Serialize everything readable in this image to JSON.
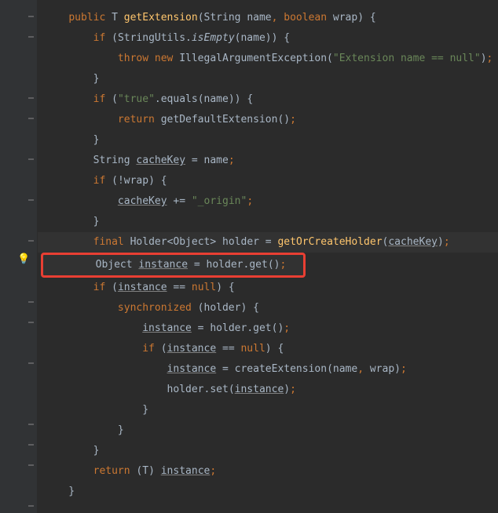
{
  "code": {
    "kw_public": "public",
    "type_T": "T",
    "method_getExtension": "getExtension",
    "type_String": "String",
    "param_name": "name",
    "kw_boolean": "boolean",
    "param_wrap": "wrap",
    "kw_if": "if",
    "cls_StringUtils": "StringUtils",
    "method_isEmpty": "isEmpty",
    "kw_throw": "throw",
    "kw_new": "new",
    "cls_IllegalArgumentException": "IllegalArgumentException",
    "str_extension_null": "\"Extension name == null\"",
    "str_true": "\"true\"",
    "method_equals": "equals",
    "kw_return": "return",
    "method_getDefaultExtension": "getDefaultExtension",
    "var_cacheKey": "cacheKey",
    "op_assign": " = ",
    "op_not": "!",
    "op_plus_assign": " += ",
    "str_origin": "\"_origin\"",
    "kw_final": "final",
    "type_Holder": "Holder",
    "type_Object": "Object",
    "var_holder": "holder",
    "method_getOrCreateHolder": "getOrCreateHolder",
    "var_instance": "instance",
    "method_get": "get",
    "kw_null": "null",
    "kw_synchronized": "synchronized",
    "method_createExtension": "createExtension",
    "method_set": "set",
    "op_eq": " == "
  }
}
